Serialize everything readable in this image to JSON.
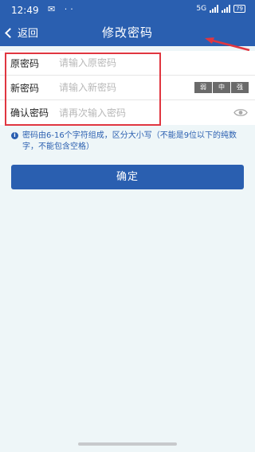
{
  "status_bar": {
    "time": "12:49",
    "left_icons": "✉ ··",
    "network": "5G",
    "battery": "79"
  },
  "nav": {
    "back_label": "返回",
    "title": "修改密码"
  },
  "form": {
    "old_password": {
      "label": "原密码",
      "placeholder": "请输入原密码"
    },
    "new_password": {
      "label": "新密码",
      "placeholder": "请输入新密码"
    },
    "confirm_password": {
      "label": "确认密码",
      "placeholder": "请再次输入密码"
    },
    "strength_levels": [
      "弱",
      "中",
      "强"
    ]
  },
  "hint": "密码由6-16个字符组成，区分大小写（不能是9位以下的纯数字，不能包含空格）",
  "confirm_button": "确定",
  "colors": {
    "primary": "#2a5fb0",
    "background": "#eef6f8",
    "annotation_red": "#e03640"
  },
  "icons": {
    "back": "chevron-left-icon",
    "eye": "eye-icon",
    "info": "info-icon"
  }
}
